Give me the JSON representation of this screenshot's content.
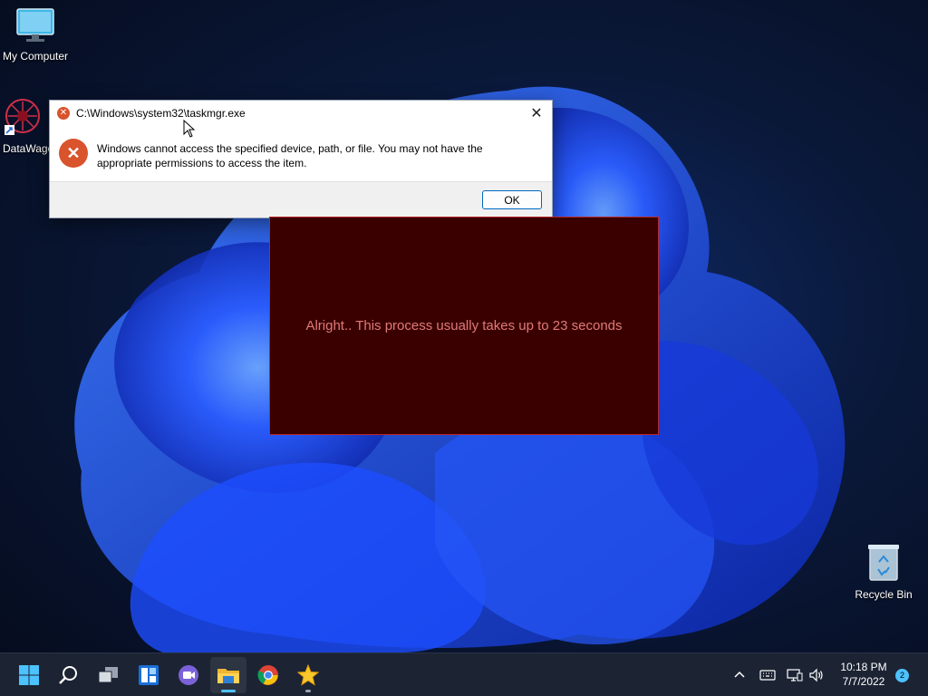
{
  "desktop": {
    "icons": [
      {
        "label": "My Computer",
        "icon": "monitor-icon"
      },
      {
        "label": "DataWago",
        "icon": "datawago-shortcut-icon"
      },
      {
        "label": "Recycle Bin",
        "icon": "recycle-bin-icon"
      }
    ]
  },
  "error_dialog": {
    "title": "C:\\Windows\\system32\\taskmgr.exe",
    "message": "Windows cannot access the specified device, path, or file. You may not have the appropriate permissions to access the item.",
    "ok_label": "OK",
    "close_glyph": "✕"
  },
  "process_window": {
    "message": "Alright.. This process usually takes up to 23 seconds"
  },
  "taskbar": {
    "apps": [
      "start-icon",
      "search-icon",
      "task-view-icon",
      "widgets-icon",
      "chat-icon",
      "file-explorer-icon",
      "chrome-icon",
      "star-app-icon"
    ],
    "clock_time": "10:18 PM",
    "clock_date": "7/7/2022",
    "notification_count": "2"
  },
  "colors": {
    "accent": "#4cc2ff",
    "error_red": "#d9532c",
    "process_bg": "#3a0000",
    "process_text": "#e07a78"
  }
}
